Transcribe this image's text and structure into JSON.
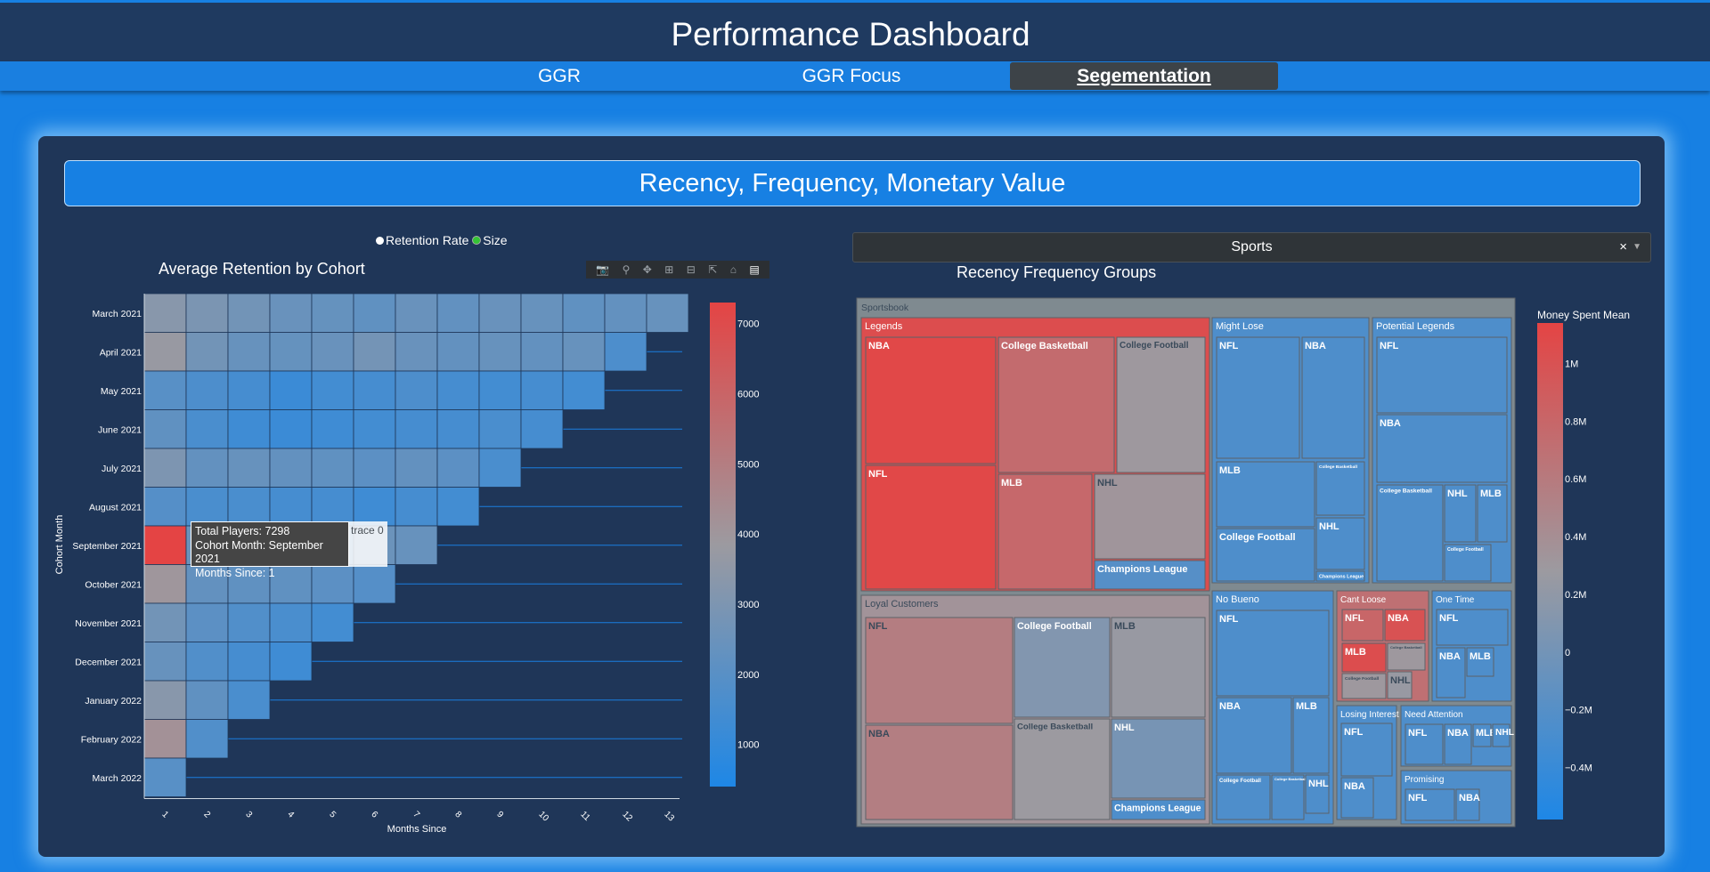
{
  "header": {
    "title": "Performance Dashboard"
  },
  "tabs": [
    {
      "label": "GGR"
    },
    {
      "label": "GGR Focus"
    },
    {
      "label": "Segementation"
    }
  ],
  "section_title": "Recency, Frequency, Monetary Value",
  "radio": {
    "options": [
      "Retention Rate",
      "Size"
    ],
    "selected": "Size",
    "selected_color": "#35c435"
  },
  "dropdown": {
    "value": "Sports",
    "clear_glyph": "×"
  },
  "modebar": [
    "camera-icon",
    "zoom-icon",
    "pan-icon",
    "zoom-in-icon",
    "zoom-out-icon",
    "autoscale-icon",
    "home-icon",
    "plotly-logo-icon"
  ],
  "tooltip": {
    "line1": "Total Players: 7298",
    "line2": "Cohort Month: September 2021",
    "line3": "Months Since: 1",
    "trace": "trace 0"
  },
  "colors": {
    "high": "#e44444",
    "mid": "#9c9aa0",
    "low": "#1e87e6"
  },
  "chart_data": [
    {
      "type": "heatmap",
      "title": "Average Retention by Cohort",
      "xlabel": "Months Since",
      "ylabel": "Cohort Month",
      "x": [
        1,
        2,
        3,
        4,
        5,
        6,
        7,
        8,
        9,
        10,
        11,
        12,
        13
      ],
      "y": [
        "March 2021",
        "April 2021",
        "May 2021",
        "June 2021",
        "July 2021",
        "August 2021",
        "September 2021",
        "October 2021",
        "November 2021",
        "December 2021",
        "January 2022",
        "February 2022",
        "March 2022"
      ],
      "z": [
        [
          3300,
          2950,
          2700,
          2450,
          2350,
          2200,
          2450,
          2250,
          2450,
          2400,
          2200,
          2300,
          2400
        ],
        [
          3750,
          2700,
          2400,
          2350,
          2450,
          2750,
          2450,
          2300,
          2400,
          2300,
          2400,
          1700
        ],
        [
          2000,
          1700,
          1500,
          1200,
          1400,
          1500,
          1700,
          1500,
          1400,
          1500,
          1400
        ],
        [
          2200,
          1600,
          1300,
          1200,
          1300,
          1400,
          1500,
          1500,
          1600,
          1500
        ],
        [
          3000,
          2300,
          2400,
          2300,
          2200,
          2100,
          2300,
          2100,
          1600
        ],
        [
          1900,
          1600,
          1600,
          1500,
          1500,
          1300,
          1500,
          1400
        ],
        [
          7298,
          2500,
          2400,
          2300,
          2200,
          2500,
          2400
        ],
        [
          4000,
          2300,
          2200,
          2200,
          2100,
          1900
        ],
        [
          2700,
          2100,
          1800,
          1600,
          1400
        ],
        [
          2400,
          1800,
          1500,
          1300
        ],
        [
          3300,
          2200,
          1600
        ],
        [
          4200,
          1800
        ],
        [
          2000
        ]
      ],
      "colorbar": {
        "ticks": [
          1000,
          2000,
          3000,
          4000,
          5000,
          6000,
          7000
        ],
        "range": [
          400,
          7300
        ]
      }
    },
    {
      "type": "treemap",
      "title": "Recency Frequency Groups",
      "root": "Sportsbook",
      "colorbar_title": "Money Spent Mean",
      "colorbar": {
        "ticks": [
          "1M",
          "0.8M",
          "0.6M",
          "0.4M",
          "0.2M",
          "0",
          "−0.2M",
          "−0.4M"
        ],
        "values": [
          1000000,
          800000,
          600000,
          400000,
          200000,
          0,
          -200000,
          -400000
        ],
        "range": [
          -580000,
          1140000
        ]
      },
      "groups": [
        {
          "name": "Legends",
          "value": 1050000,
          "children": [
            {
              "name": "NBA",
              "value": 1100000
            },
            {
              "name": "College Basketball",
              "value": 750000
            },
            {
              "name": "College Football",
              "value": 300000
            },
            {
              "name": "NFL",
              "value": 1100000
            },
            {
              "name": "MLB",
              "value": 780000
            },
            {
              "name": "NHL",
              "value": 330000
            },
            {
              "name": "Champions League",
              "value": -200000
            }
          ]
        },
        {
          "name": "Might Lose",
          "value": -250000,
          "children": [
            {
              "name": "NFL",
              "value": -250000
            },
            {
              "name": "NBA",
              "value": -250000
            },
            {
              "name": "MLB",
              "value": -250000
            },
            {
              "name": "College Basketball",
              "value": -250000
            },
            {
              "name": "College Football",
              "value": -250000
            },
            {
              "name": "NHL",
              "value": -250000
            },
            {
              "name": "Champions League",
              "value": -300000
            }
          ]
        },
        {
          "name": "Potential Legends",
          "value": -250000,
          "children": [
            {
              "name": "NFL",
              "value": -250000
            },
            {
              "name": "NBA",
              "value": -250000
            },
            {
              "name": "College Basketball",
              "value": -250000
            },
            {
              "name": "NHL",
              "value": -250000
            },
            {
              "name": "MLB",
              "value": -250000
            },
            {
              "name": "College Football",
              "value": -250000
            }
          ]
        },
        {
          "name": "Loyal Customers",
          "value": 350000,
          "children": [
            {
              "name": "NFL",
              "value": 570000
            },
            {
              "name": "College Football",
              "value": 100000
            },
            {
              "name": "MLB",
              "value": 250000
            },
            {
              "name": "NBA",
              "value": 560000
            },
            {
              "name": "College Basketball",
              "value": 280000
            },
            {
              "name": "NHL",
              "value": 30000
            },
            {
              "name": "Champions League",
              "value": -250000
            }
          ]
        },
        {
          "name": "No Bueno",
          "value": -250000,
          "children": [
            {
              "name": "NFL",
              "value": -250000
            },
            {
              "name": "NBA",
              "value": -250000
            },
            {
              "name": "MLB",
              "value": -250000
            },
            {
              "name": "College Football",
              "value": -250000
            },
            {
              "name": "College Basketball",
              "value": -250000
            },
            {
              "name": "NHL",
              "value": -250000
            }
          ]
        },
        {
          "name": "Cant Loose",
          "value": 700000,
          "children": [
            {
              "name": "NFL",
              "value": 800000
            },
            {
              "name": "NBA",
              "value": 1000000
            },
            {
              "name": "MLB",
              "value": 1050000
            },
            {
              "name": "College Basketball",
              "value": 300000
            },
            {
              "name": "College Football",
              "value": 300000
            },
            {
              "name": "NHL",
              "value": 250000
            }
          ]
        },
        {
          "name": "One Time",
          "value": -250000,
          "children": [
            {
              "name": "NFL",
              "value": -250000
            },
            {
              "name": "NBA",
              "value": -250000
            },
            {
              "name": "MLB",
              "value": -250000
            }
          ]
        },
        {
          "name": "Losing Interest",
          "value": -250000,
          "children": [
            {
              "name": "NFL",
              "value": -250000
            },
            {
              "name": "NBA",
              "value": -250000
            }
          ]
        },
        {
          "name": "Need Attention",
          "value": -250000,
          "children": [
            {
              "name": "NFL",
              "value": -250000
            },
            {
              "name": "NBA",
              "value": -250000
            },
            {
              "name": "MLB",
              "value": -250000
            },
            {
              "name": "NHL",
              "value": -250000
            }
          ]
        },
        {
          "name": "Promising",
          "value": -250000,
          "children": [
            {
              "name": "NFL",
              "value": -250000
            },
            {
              "name": "NBA",
              "value": -250000
            }
          ]
        }
      ]
    }
  ]
}
